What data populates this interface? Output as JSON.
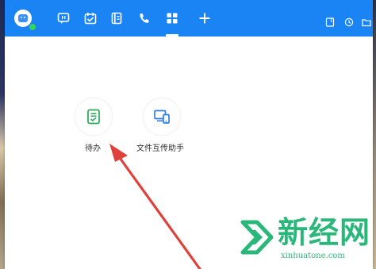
{
  "nav": {
    "items": [
      {
        "icon": "chat-icon",
        "active": false
      },
      {
        "icon": "calendar-check-icon",
        "active": false
      },
      {
        "icon": "contacts-book-icon",
        "active": false
      },
      {
        "icon": "phone-icon",
        "active": false
      },
      {
        "icon": "workbench-grid-icon",
        "active": true
      },
      {
        "icon": "plus-icon",
        "active": false
      }
    ],
    "system_icons": [
      "notebook-icon",
      "history-clock-icon",
      "folder-icon"
    ]
  },
  "apps": [
    {
      "label": "待办",
      "icon": "todo-checklist-icon",
      "color": "#2aa85a"
    },
    {
      "label": "文件互传助手",
      "icon": "file-transfer-icon",
      "color": "#2f7de8"
    }
  ],
  "watermark": {
    "title": "新经网",
    "url": "xinhuatone.com",
    "color": "#2ab87a"
  },
  "colors": {
    "titlebar": "#1b84f5",
    "annotation_arrow": "#e0413a"
  }
}
